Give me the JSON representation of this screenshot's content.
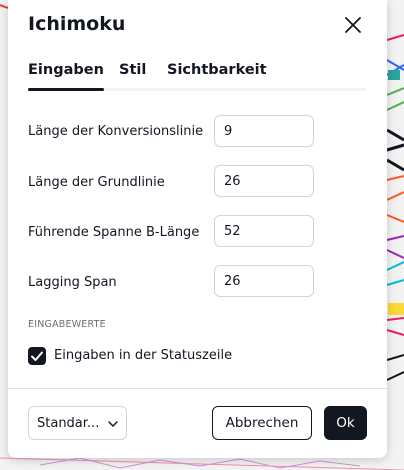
{
  "dialog": {
    "title": "Ichimoku",
    "tabs": [
      {
        "label": "Eingaben",
        "active": true
      },
      {
        "label": "Stil",
        "active": false
      },
      {
        "label": "Sichtbarkeit",
        "active": false
      }
    ],
    "inputs": [
      {
        "label": "Länge der Konversionslinie",
        "value": "9"
      },
      {
        "label": "Länge der Grundlinie",
        "value": "26"
      },
      {
        "label": "Führende Spanne B-Länge",
        "value": "52"
      },
      {
        "label": "Lagging Span",
        "value": "26"
      }
    ],
    "section_label": "EINGABEWERTE",
    "checkbox": {
      "label": "Eingaben in der Statuszeile",
      "checked": true
    },
    "footer": {
      "template_select": "Standar...",
      "cancel_label": "Abbrechen",
      "ok_label": "Ok"
    }
  },
  "colors": {
    "text": "#131722",
    "primary_button": "#131722",
    "border": "#d1d4dc",
    "muted": "#6a6d78"
  },
  "icons": [
    "close-icon",
    "chevron-down-icon",
    "checkmark-icon"
  ]
}
